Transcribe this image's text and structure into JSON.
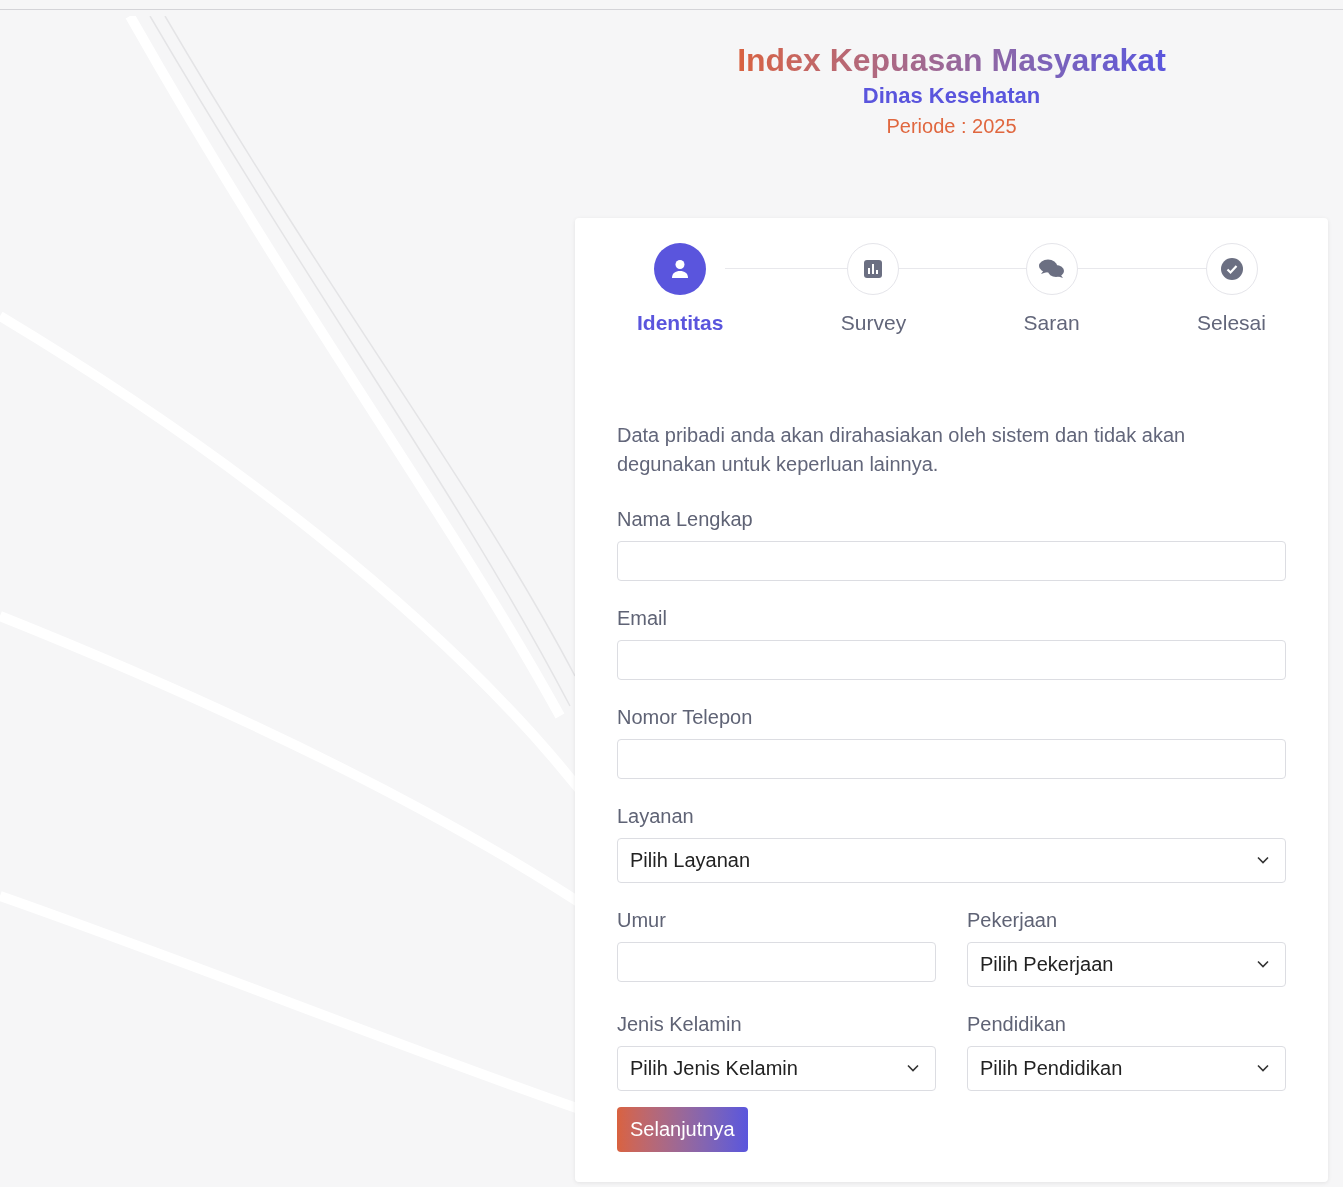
{
  "header": {
    "title": "Index Kepuasan Masyarakat",
    "subtitle": "Dinas Kesehatan",
    "period": "Periode : 2025"
  },
  "steps": [
    {
      "label": "Identitas",
      "kind": "user",
      "selected": true
    },
    {
      "label": "Survey",
      "kind": "chart",
      "selected": false
    },
    {
      "label": "Saran",
      "kind": "chat",
      "selected": false
    },
    {
      "label": "Selesai",
      "kind": "check",
      "selected": false
    }
  ],
  "intro": "Data pribadi anda akan dirahasiakan oleh sistem dan tidak akan degunakan untuk keperluan lainnya.",
  "form_rows": [
    [
      {
        "label": "Nama Lengkap",
        "kind": "text"
      }
    ],
    [
      {
        "label": "Email",
        "kind": "text"
      }
    ],
    [
      {
        "label": "Nomor Telepon",
        "kind": "text"
      }
    ],
    [
      {
        "label": "Layanan",
        "kind": "select",
        "value": "Pilih Layanan"
      }
    ],
    [
      {
        "label": "Umur",
        "kind": "text"
      },
      {
        "label": "Pekerjaan",
        "kind": "select",
        "value": "Pilih Pekerjaan"
      }
    ],
    [
      {
        "label": "Jenis Kelamin",
        "kind": "select",
        "value": "Pilih Jenis Kelamin"
      },
      {
        "label": "Pendidikan",
        "kind": "select",
        "value": "Pilih Pendidikan"
      }
    ]
  ],
  "next_button": "Selanjutnya"
}
